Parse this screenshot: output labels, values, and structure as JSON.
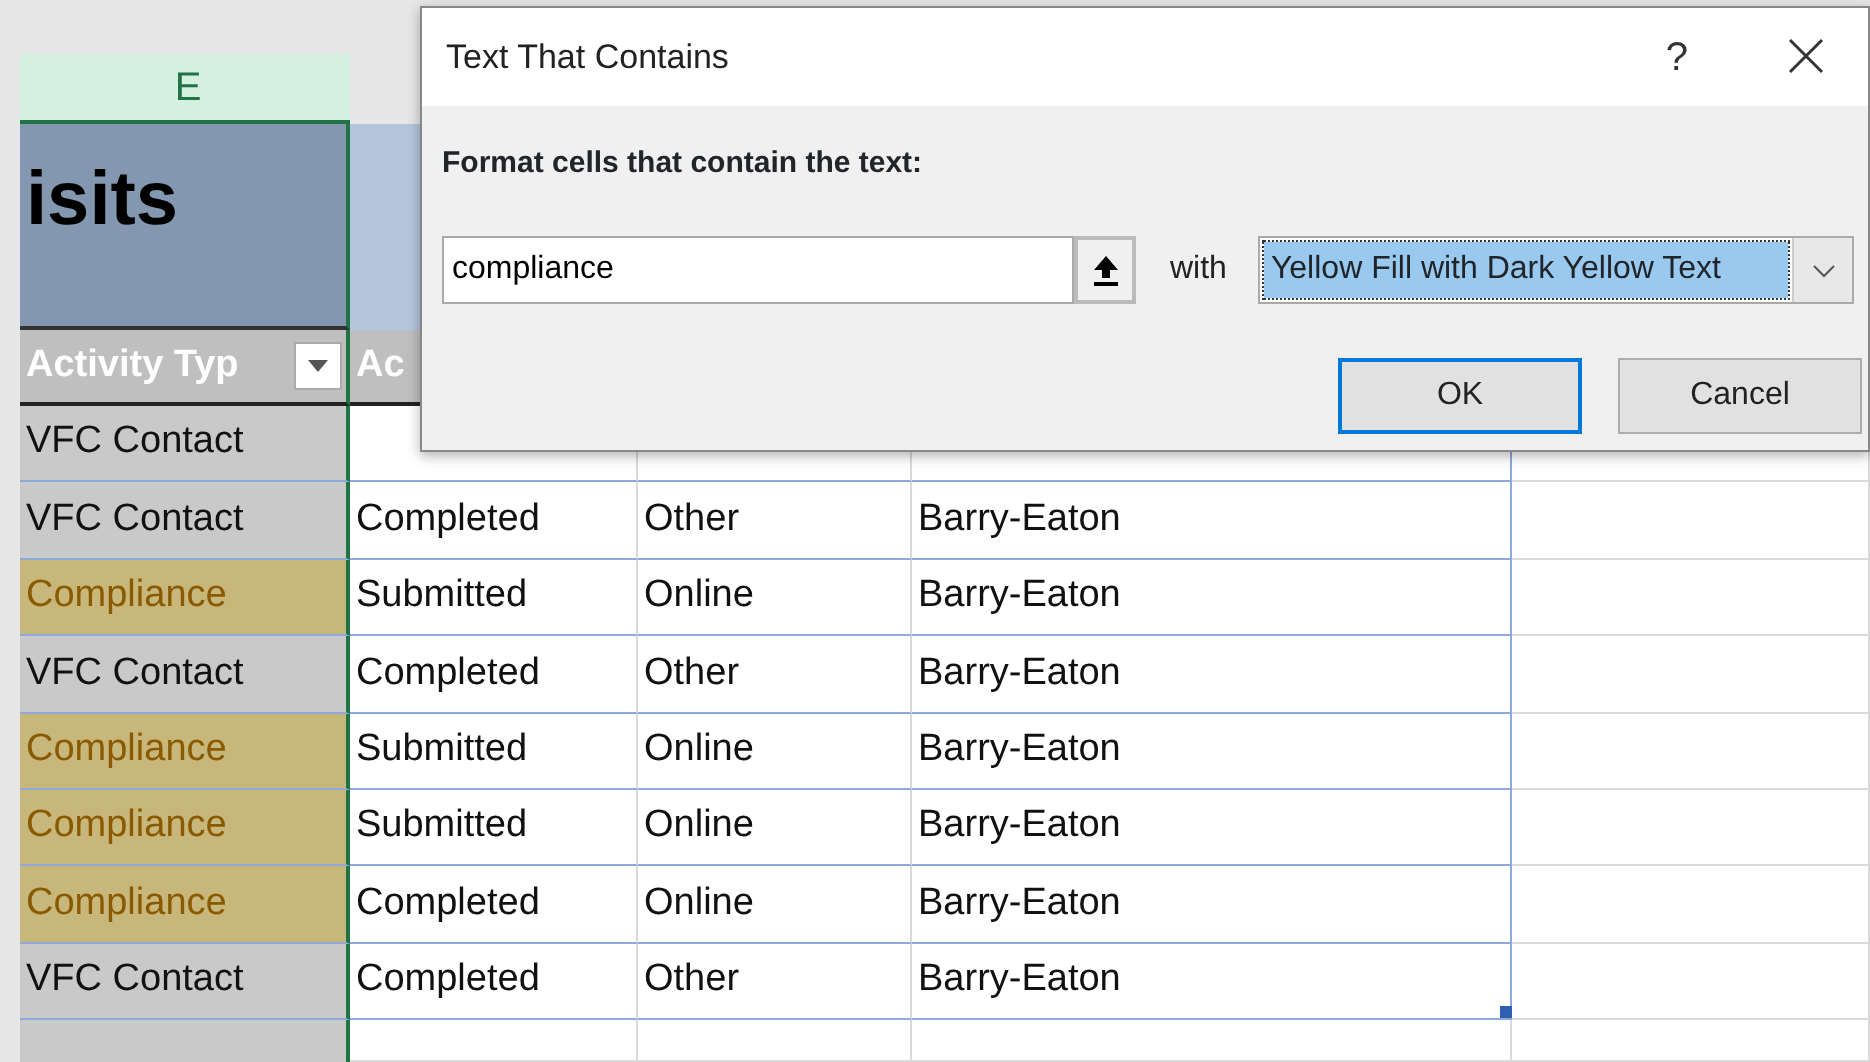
{
  "sheet": {
    "column_header": {
      "label": "E",
      "selected": true
    },
    "title": "isits",
    "columns": [
      {
        "label": "Activity Typ",
        "filter": true
      },
      {
        "label": "Ac",
        "filter": false
      }
    ],
    "rows": [
      {
        "cells": [
          "VFC Contact"
        ],
        "highlighted": false
      },
      {
        "cells": [
          "VFC Contact",
          "Completed",
          "Other",
          "Barry-Eaton"
        ],
        "highlighted": false
      },
      {
        "cells": [
          "Compliance",
          "Submitted",
          "Online",
          "Barry-Eaton"
        ],
        "highlighted": true
      },
      {
        "cells": [
          "VFC Contact",
          "Completed",
          "Other",
          "Barry-Eaton"
        ],
        "highlighted": false
      },
      {
        "cells": [
          "Compliance",
          "Submitted",
          "Online",
          "Barry-Eaton"
        ],
        "highlighted": true
      },
      {
        "cells": [
          "Compliance",
          "Submitted",
          "Online",
          "Barry-Eaton"
        ],
        "highlighted": true
      },
      {
        "cells": [
          "Compliance",
          "Completed",
          "Online",
          "Barry-Eaton"
        ],
        "highlighted": true
      },
      {
        "cells": [
          "VFC Contact",
          "Completed",
          "Other",
          "Barry-Eaton"
        ],
        "highlighted": false
      }
    ]
  },
  "dialog": {
    "title": "Text That Contains",
    "help": "?",
    "prompt": "Format cells that contain the text:",
    "text_value": "compliance",
    "with_label": "with",
    "format": {
      "value": "Yellow Fill with Dark Yellow Text",
      "selected": true
    },
    "buttons": [
      {
        "label": "OK",
        "default": true
      },
      {
        "label": "Cancel",
        "default": false
      }
    ]
  }
}
